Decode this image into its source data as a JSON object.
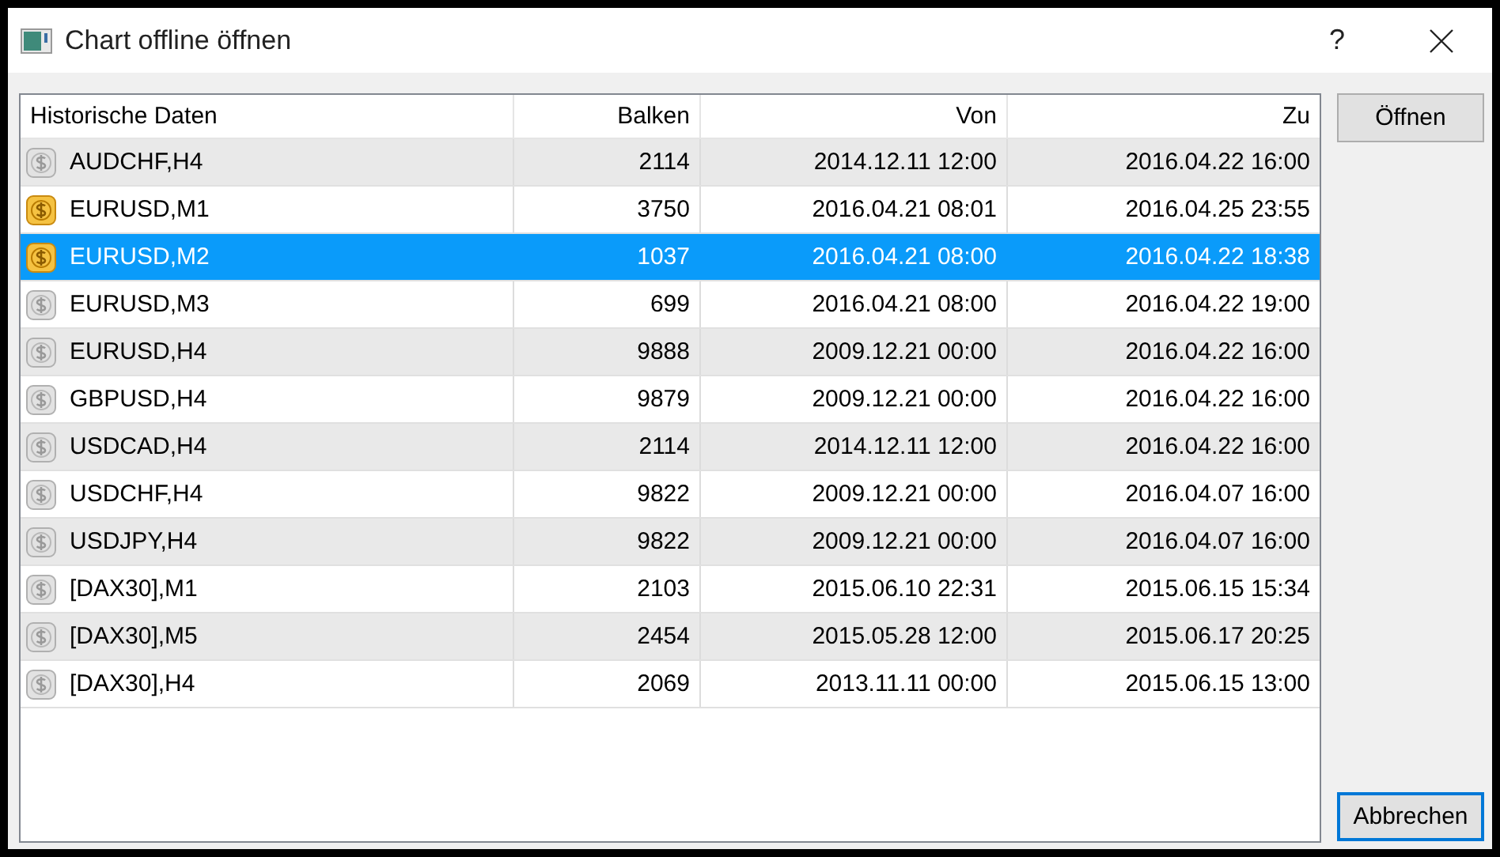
{
  "window": {
    "title": "Chart offline öffnen",
    "help": "?"
  },
  "table": {
    "columns": [
      "Historische Daten",
      "Balken",
      "Von",
      "Zu"
    ],
    "rows": [
      {
        "symbol": "AUDCHF,H4",
        "bars": "2114",
        "from": "2014.12.11 12:00",
        "to": "2016.04.22 16:00",
        "active": false,
        "selected": false
      },
      {
        "symbol": "EURUSD,M1",
        "bars": "3750",
        "from": "2016.04.21 08:01",
        "to": "2016.04.25 23:55",
        "active": true,
        "selected": false
      },
      {
        "symbol": "EURUSD,M2",
        "bars": "1037",
        "from": "2016.04.21 08:00",
        "to": "2016.04.22 18:38",
        "active": true,
        "selected": true
      },
      {
        "symbol": "EURUSD,M3",
        "bars": "699",
        "from": "2016.04.21 08:00",
        "to": "2016.04.22 19:00",
        "active": false,
        "selected": false
      },
      {
        "symbol": "EURUSD,H4",
        "bars": "9888",
        "from": "2009.12.21 00:00",
        "to": "2016.04.22 16:00",
        "active": false,
        "selected": false
      },
      {
        "symbol": "GBPUSD,H4",
        "bars": "9879",
        "from": "2009.12.21 00:00",
        "to": "2016.04.22 16:00",
        "active": false,
        "selected": false
      },
      {
        "symbol": "USDCAD,H4",
        "bars": "2114",
        "from": "2014.12.11 12:00",
        "to": "2016.04.22 16:00",
        "active": false,
        "selected": false
      },
      {
        "symbol": "USDCHF,H4",
        "bars": "9822",
        "from": "2009.12.21 00:00",
        "to": "2016.04.07 16:00",
        "active": false,
        "selected": false
      },
      {
        "symbol": "USDJPY,H4",
        "bars": "9822",
        "from": "2009.12.21 00:00",
        "to": "2016.04.07 16:00",
        "active": false,
        "selected": false
      },
      {
        "symbol": "[DAX30],M1",
        "bars": "2103",
        "from": "2015.06.10 22:31",
        "to": "2015.06.15 15:34",
        "active": false,
        "selected": false
      },
      {
        "symbol": "[DAX30],M5",
        "bars": "2454",
        "from": "2015.05.28 12:00",
        "to": "2015.06.17 20:25",
        "active": false,
        "selected": false
      },
      {
        "symbol": "[DAX30],H4",
        "bars": "2069",
        "from": "2013.11.11 00:00",
        "to": "2015.06.15 13:00",
        "active": false,
        "selected": false
      }
    ]
  },
  "buttons": [
    {
      "label": "Öffnen",
      "default": false
    },
    {
      "label": "Abbrechen",
      "default": true
    }
  ]
}
